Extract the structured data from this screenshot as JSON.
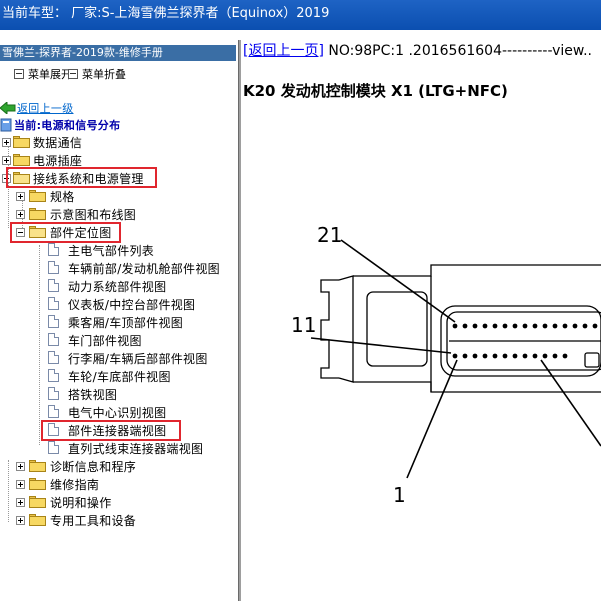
{
  "titlebar": {
    "text": "当前车型： 厂家:S-上海雪佛兰探界者（Equinox）2019"
  },
  "left_panel": {
    "manual_title": "雪佛兰-探界者-2019款-维修手册",
    "toolbar": {
      "expand_label": "菜单展开",
      "collapse_label": "菜单折叠"
    },
    "back_link": "返回上一级",
    "current_label": "当前:电源和信号分布",
    "tree": {
      "top_items": [
        "数据通信",
        "电源插座",
        "接线系统和电源管理"
      ],
      "wiring_children": [
        "规格",
        "示意图和布线图",
        "部件定位图"
      ],
      "component_location_children": [
        "主电气部件列表",
        "车辆前部/发动机舱部件视图",
        "动力系统部件视图",
        "仪表板/中控台部件视图",
        "乘客厢/车顶部件视图",
        "车门部件视图",
        "行李厢/车辆后部部件视图",
        "车轮/车底部件视图",
        "搭铁视图",
        "电气中心识别视图",
        "部件连接器端视图",
        "直列式线束连接器端视图"
      ],
      "bottom_items": [
        "诊断信息和程序",
        "维修指南",
        "说明和操作",
        "专用工具和设备"
      ]
    }
  },
  "right_panel": {
    "back_link": "[返回上一页]",
    "meta_text": " NO:98PC:1 .2016561604----------view..",
    "doc_title": "K20 发动机控制模块 X1 (LTG+NFC)",
    "callouts": [
      "21",
      "11",
      "1"
    ]
  },
  "colors": {
    "highlight_box": "#e0262e",
    "titlebar": "#1e63c4",
    "link": "#0000ee"
  }
}
